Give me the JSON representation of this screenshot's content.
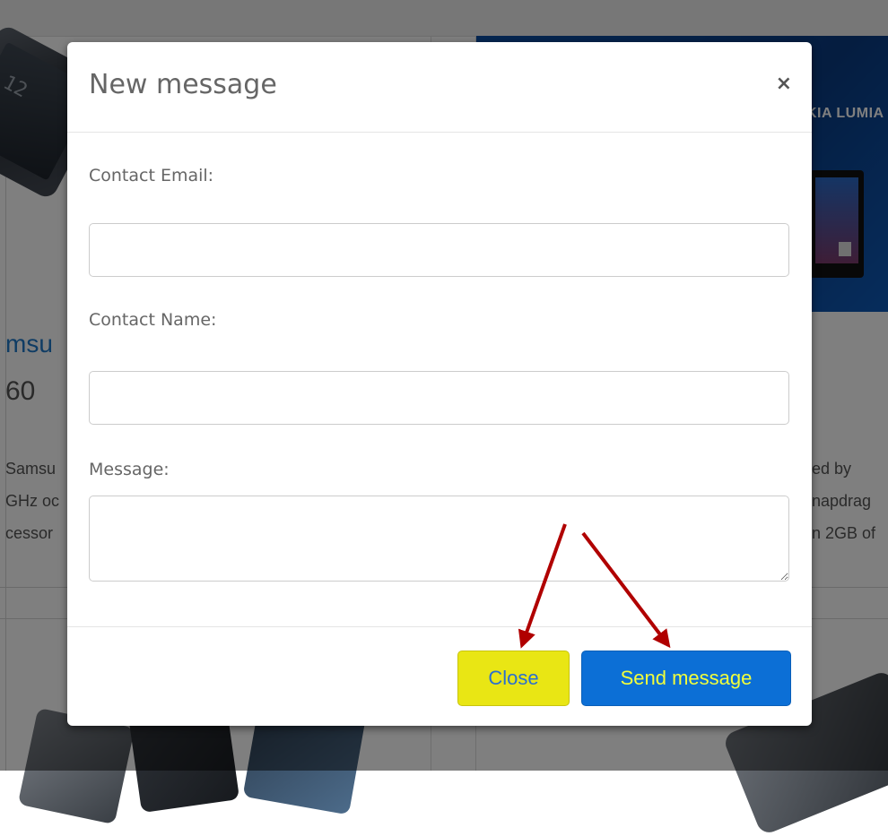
{
  "background": {
    "left_phone_screen_text": "12",
    "banner_text": "KIA LUMIA",
    "left_title_fragment": "msu",
    "left_price_fragment": "60",
    "left_description_fragments": [
      "Samsu",
      "GHz oc",
      "cessor"
    ],
    "right_description_fragments": [
      "ed by",
      "napdrag",
      "n 2GB of"
    ],
    "colors": {
      "backdrop": "rgba(0,0,0,0.5)",
      "banner_blue": "#0b4da3",
      "title_link_blue": "#1e78c8"
    }
  },
  "modal": {
    "title": "New message",
    "close_icon": "close-icon",
    "close_glyph": "×",
    "fields": [
      {
        "label": "Contact Email:",
        "value": "",
        "placeholder": ""
      },
      {
        "label": "Contact Name:",
        "value": "",
        "placeholder": ""
      },
      {
        "label": "Message:",
        "value": "",
        "placeholder": ""
      }
    ],
    "buttons": {
      "close_label": "Close",
      "send_label": "Send message"
    },
    "colors": {
      "close_button_bg": "#e9e614",
      "close_button_text": "#2a6fd0",
      "send_button_bg": "#0c6fd6",
      "send_button_text": "#f2ff3b"
    }
  },
  "annotations": {
    "arrows": [
      "arrow-to-close-button",
      "arrow-to-send-button"
    ],
    "arrow_color": "#b00000"
  }
}
